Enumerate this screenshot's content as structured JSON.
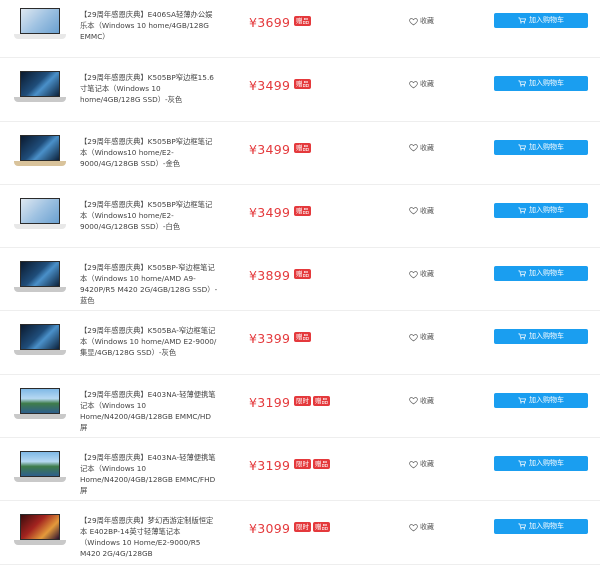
{
  "colors": {
    "price": "#e4393c",
    "button": "#1a9ef0",
    "tag": "#e4393c"
  },
  "favorite_label": "收藏",
  "add_to_cart_label": "加入购物车",
  "products": [
    {
      "name": "【29周年感恩庆典】E406SA轻薄办公娱乐本（Windows 10 home/4GB/128G EMMC）",
      "price": "¥3699",
      "tags": [
        "赠品"
      ],
      "thumb": "white"
    },
    {
      "name": "【29周年感恩庆典】K505BP窄边框15.6寸笔记本（Windows 10 home/4GB/128G SSD）-灰色",
      "price": "¥3499",
      "tags": [
        "赠品"
      ],
      "thumb": "gray"
    },
    {
      "name": "【29周年感恩庆典】K505BP窄边框笔记本（Windows10 home/E2-9000/4G/128GB SSD）-金色",
      "price": "¥3499",
      "tags": [
        "赠品"
      ],
      "thumb": "gold"
    },
    {
      "name": "【29周年感恩庆典】K505BP窄边框笔记本（Windows10 home/E2-9000/4G/128GB SSD）-白色",
      "price": "¥3499",
      "tags": [
        "赠品"
      ],
      "thumb": "white"
    },
    {
      "name": "【29周年感恩庆典】K505BP-窄边框笔记本（Windows 10 home/AMD A9-9420P/R5 M420 2G/4GB/128G SSD）-蓝色",
      "price": "¥3899",
      "tags": [
        "赠品"
      ],
      "thumb": "gray"
    },
    {
      "name": "【29周年感恩庆典】K505BA-窄边框笔记本（Windows 10 home/AMD E2-9000/集显/4GB/128G SSD）-灰色",
      "price": "¥3399",
      "tags": [
        "赠品"
      ],
      "thumb": "gray"
    },
    {
      "name": "【29周年感恩庆典】E403NA-轻薄便携笔记本（Windows 10 Home/N4200/4GB/128GB EMMC/HD屏",
      "price": "¥3199",
      "tags": [
        "限时",
        "赠品"
      ],
      "thumb": "lake"
    },
    {
      "name": "【29周年感恩庆典】E403NA-轻薄便携笔记本（Windows 10 Home/N4200/4GB/128GB EMMC/FHD 屏",
      "price": "¥3199",
      "tags": [
        "限时",
        "赠品"
      ],
      "thumb": "lake"
    },
    {
      "name": "【29周年感恩庆典】梦幻西游定制版恒定本 E402BP-14英寸轻薄笔记本（Windows 10 Home/E2-9000/R5 M420 2G/4G/128GB",
      "price": "¥3099",
      "tags": [
        "限时",
        "赠品"
      ],
      "thumb": "game"
    }
  ]
}
